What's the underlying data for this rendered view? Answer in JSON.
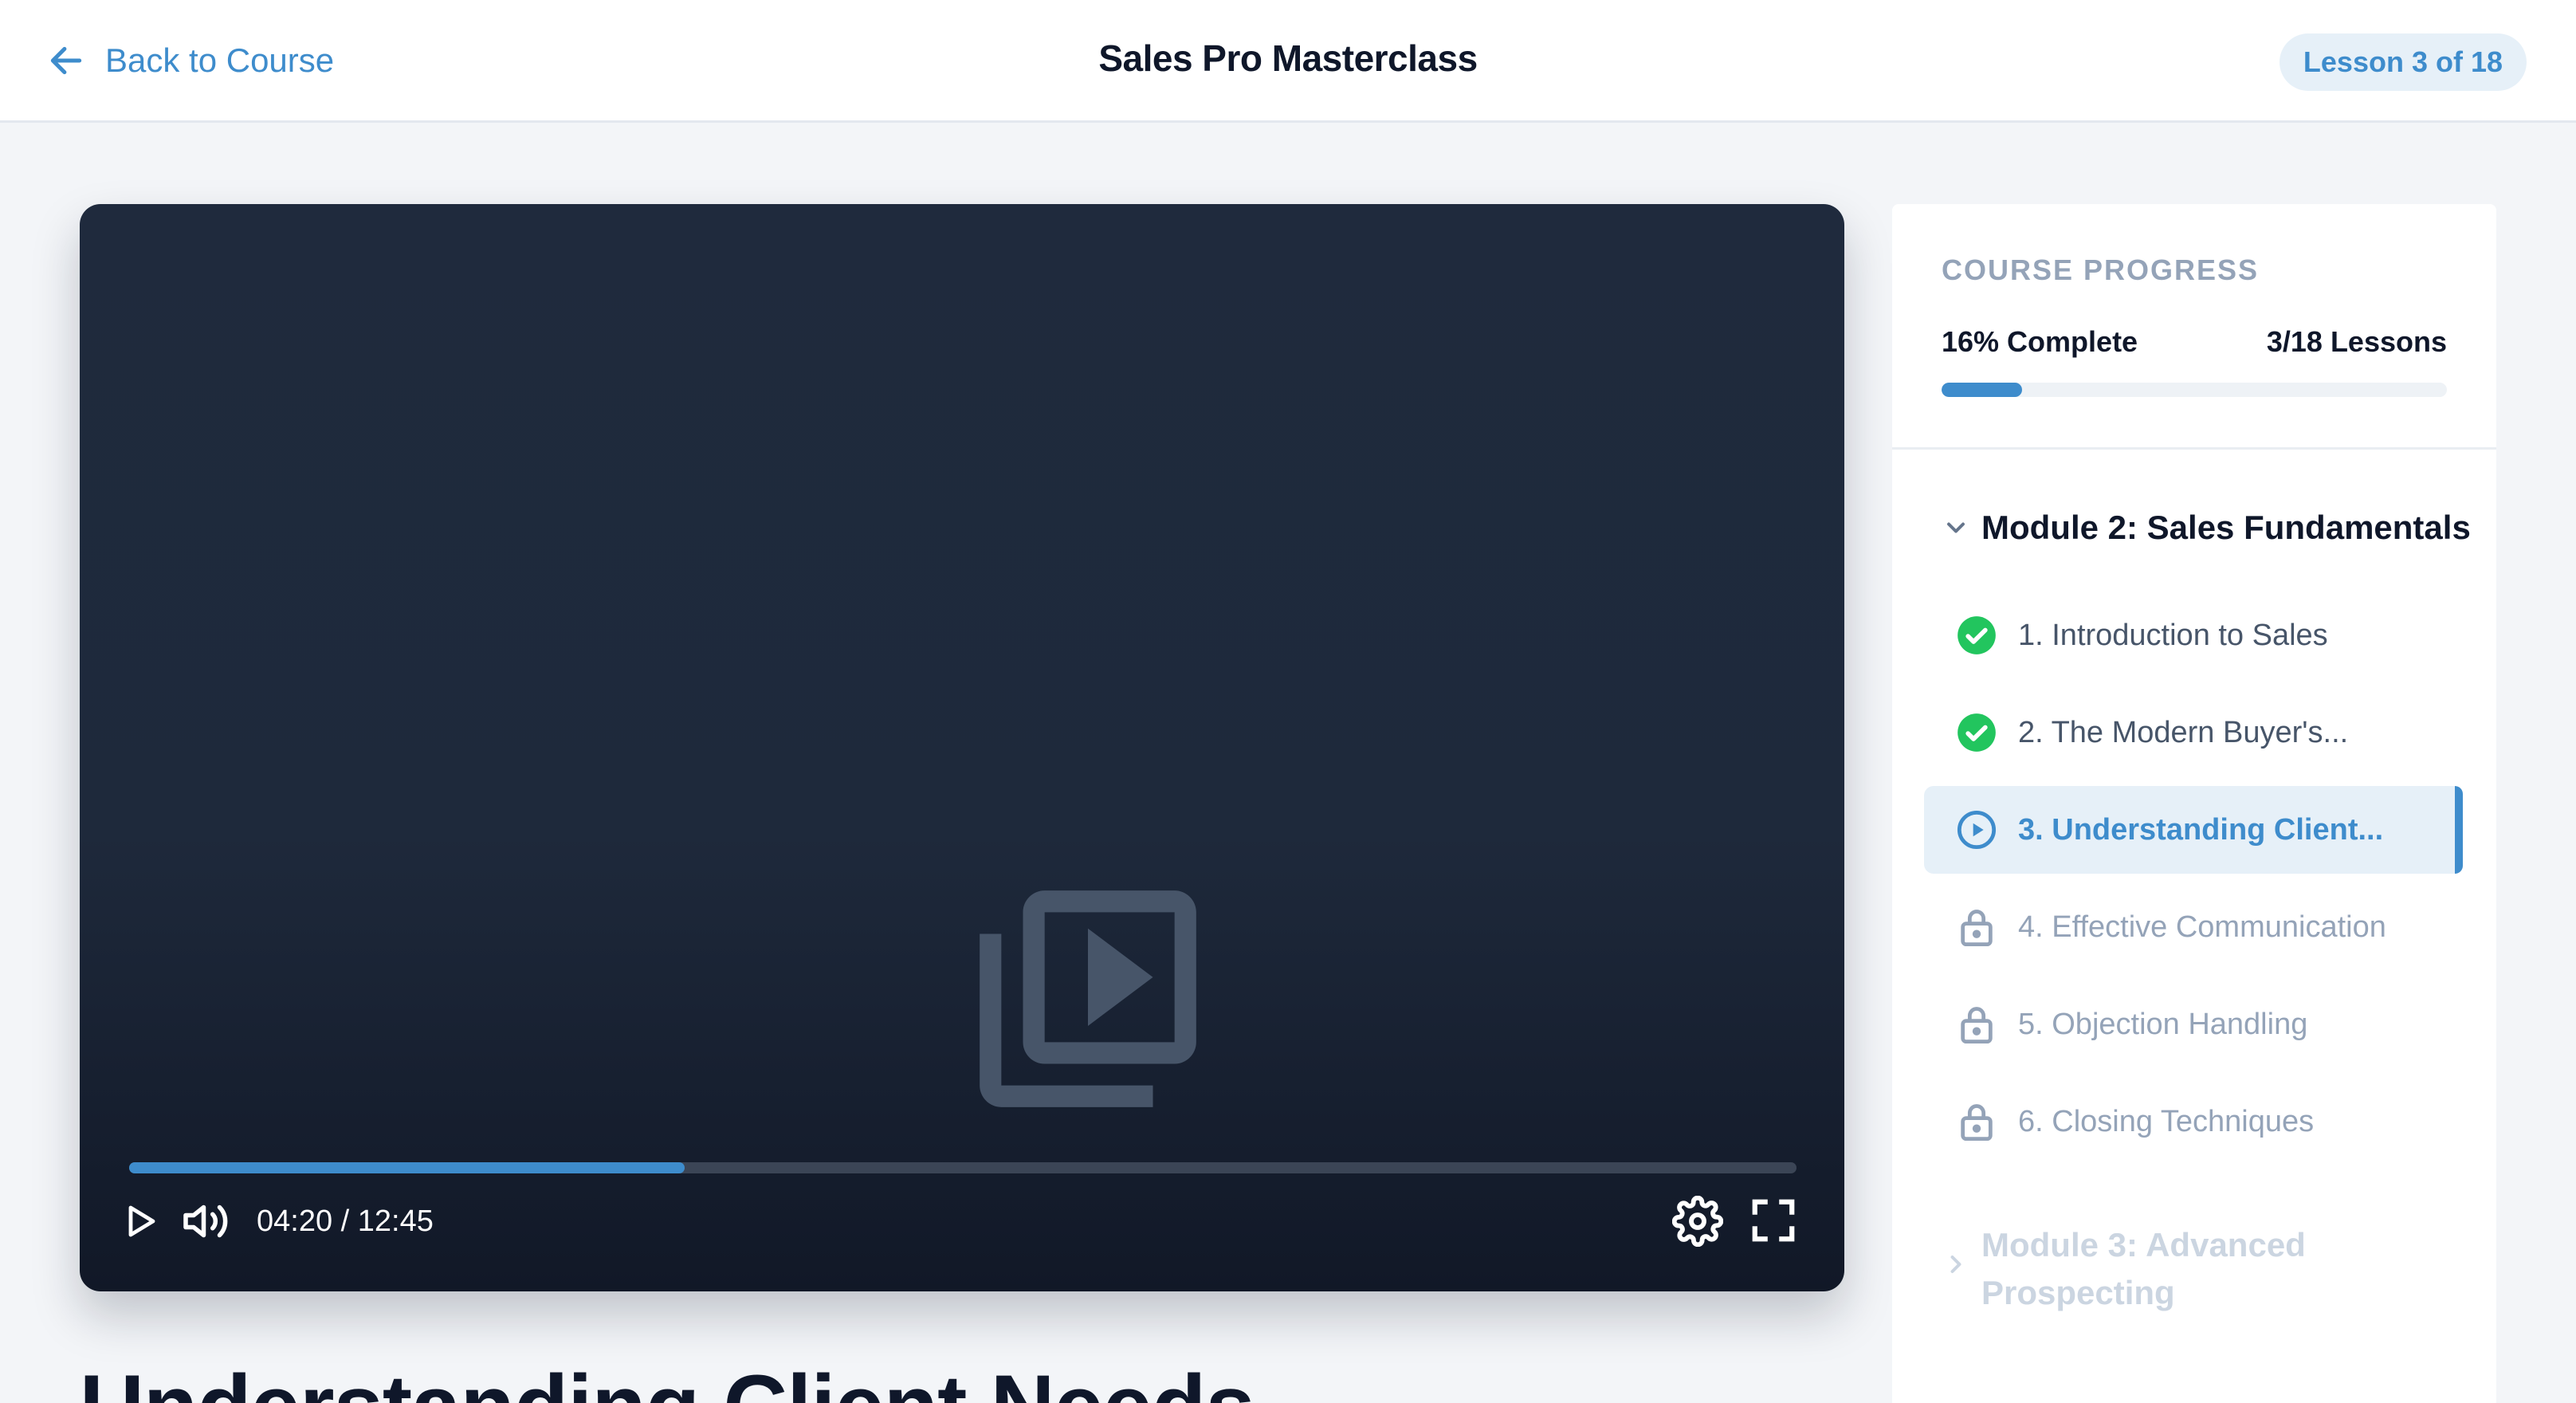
{
  "header": {
    "back_label": "Back to Course",
    "course_title": "Sales Pro Masterclass",
    "lesson_badge": "Lesson 3 of 18"
  },
  "player": {
    "time": "04:20 / 12:45",
    "progress_fraction": 0.333,
    "icons": {
      "center": "video-library-icon",
      "play": "play-icon",
      "volume": "volume-icon",
      "settings": "gear-icon",
      "fullscreen": "fullscreen-icon"
    }
  },
  "lesson": {
    "heading": "Understanding Client Needs"
  },
  "sidebar": {
    "caption": "COURSE PROGRESS",
    "percent_label": "16% Complete",
    "lessons_label": "3/18 Lessons",
    "progress_fraction": 0.16,
    "module_current": "Module 2: Sales Fundamentals",
    "lessons": [
      {
        "label": "1. Introduction to Sales",
        "status": "completed",
        "icon": "check-circle-icon"
      },
      {
        "label": "2. The Modern Buyer's...",
        "status": "completed",
        "icon": "check-circle-icon"
      },
      {
        "label": "3. Understanding Client...",
        "status": "active",
        "icon": "play-circle-icon"
      },
      {
        "label": "4. Effective Communication",
        "status": "locked",
        "icon": "lock-icon"
      },
      {
        "label": "5. Objection Handling",
        "status": "locked",
        "icon": "lock-icon"
      },
      {
        "label": "6. Closing Techniques",
        "status": "locked",
        "icon": "lock-icon"
      }
    ],
    "module_next": "Module 3: Advanced Prospecting"
  },
  "colors": {
    "accent": "#3e8ccc",
    "success": "#22c55e",
    "locked": "#94a3b8",
    "video_bg": "#1e293b"
  }
}
